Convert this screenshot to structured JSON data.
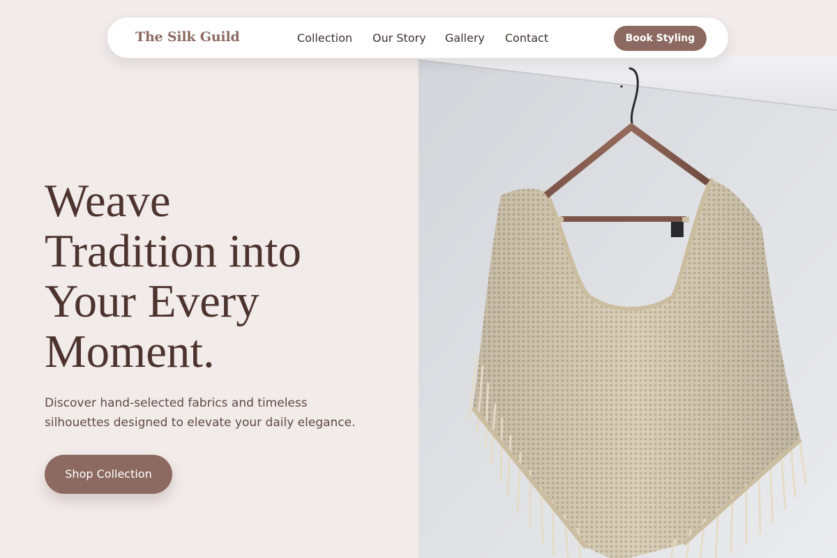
{
  "brand": {
    "name": "The Silk Guild"
  },
  "nav": {
    "links": [
      {
        "label": "Collection"
      },
      {
        "label": "Our Story"
      },
      {
        "label": "Gallery"
      },
      {
        "label": "Contact"
      }
    ],
    "cta_label": "Book Styling"
  },
  "hero": {
    "title_lines": [
      "Weave",
      "Tradition into",
      "Your Every",
      "Moment."
    ],
    "subtitle_lines": [
      "Discover hand-selected fabrics and timeless",
      "silhouettes designed to elevate your daily elegance."
    ],
    "cta_label": "Shop Collection"
  },
  "image": {
    "subject": "cream crochet poncho with fringe on wooden hanger"
  },
  "colors": {
    "background": "#f1ebea",
    "accent": "#8d6a61",
    "heading": "#4d332e",
    "body_text": "#5f4943"
  }
}
